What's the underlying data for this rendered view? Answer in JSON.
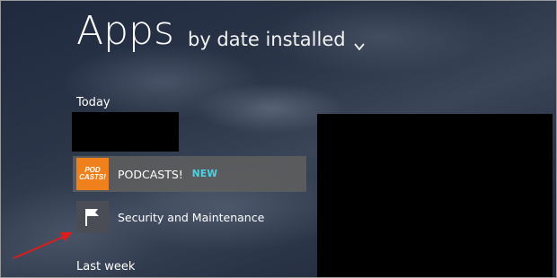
{
  "header": {
    "title": "Apps",
    "sort_label": "by date installed"
  },
  "groups": [
    {
      "label": "Today",
      "apps": [
        {
          "name": "PODCASTS!",
          "badge": "NEW",
          "icon_text": "POD\nCASTS!",
          "icon": "podcasts-logo-icon"
        },
        {
          "name": "Security and Maintenance",
          "icon": "flag-icon"
        }
      ]
    },
    {
      "label": "Last week"
    }
  ],
  "colors": {
    "accent_badge": "#4cd3e6",
    "podcasts_icon_bg": "#f0801c",
    "selected_tile_bg": "#5f5f5f",
    "annotation_arrow": "#e01b1b"
  }
}
